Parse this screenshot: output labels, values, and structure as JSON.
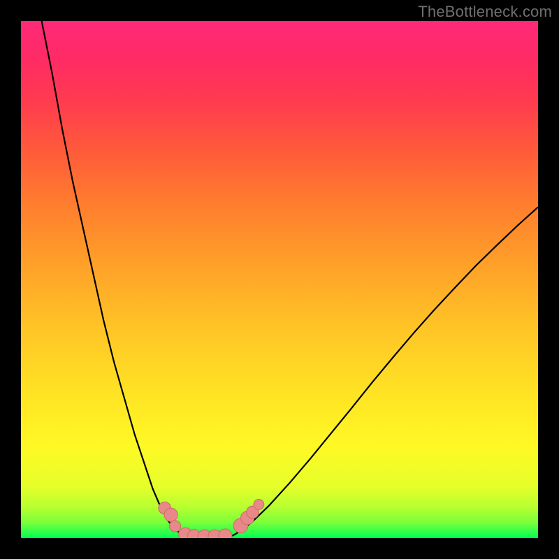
{
  "watermark": "TheBottleneck.com",
  "chart_data": {
    "type": "line",
    "title": "",
    "xlabel": "",
    "ylabel": "",
    "xlim": [
      0,
      100
    ],
    "ylim": [
      0,
      100
    ],
    "grid": false,
    "legend": null,
    "background_gradient": {
      "stops": [
        {
          "pos": 0,
          "color": "#00ff55"
        },
        {
          "pos": 3,
          "color": "#7aff3a"
        },
        {
          "pos": 6,
          "color": "#b8ff30"
        },
        {
          "pos": 10,
          "color": "#e6ff2a"
        },
        {
          "pos": 18,
          "color": "#fff825"
        },
        {
          "pos": 28,
          "color": "#ffe324"
        },
        {
          "pos": 40,
          "color": "#ffc626"
        },
        {
          "pos": 52,
          "color": "#ffa328"
        },
        {
          "pos": 64,
          "color": "#ff7f2e"
        },
        {
          "pos": 75,
          "color": "#ff5a3a"
        },
        {
          "pos": 85,
          "color": "#ff3a50"
        },
        {
          "pos": 93,
          "color": "#ff2a66"
        },
        {
          "pos": 100,
          "color": "#ff2a78"
        }
      ]
    },
    "series": [
      {
        "name": "left-curve",
        "x": [
          4,
          6,
          8,
          10,
          12,
          14,
          16,
          18,
          20,
          22,
          24,
          25.5,
          27,
          28.5,
          30,
          31.5
        ],
        "y": [
          100,
          90,
          79,
          69,
          60,
          51,
          42,
          34,
          27,
          20,
          14,
          9.5,
          6,
          3.3,
          1.5,
          0.5
        ]
      },
      {
        "name": "valley-floor",
        "x": [
          31.5,
          33,
          35,
          37,
          39,
          41
        ],
        "y": [
          0.5,
          0.15,
          0.05,
          0.05,
          0.15,
          0.5
        ]
      },
      {
        "name": "right-curve",
        "x": [
          41,
          43,
          45,
          48,
          52,
          56,
          60,
          64,
          68,
          72,
          76,
          80,
          84,
          88,
          92,
          96,
          100
        ],
        "y": [
          0.5,
          1.7,
          3.4,
          6.3,
          10.7,
          15.4,
          20.3,
          25.2,
          30.2,
          35.0,
          39.7,
          44.2,
          48.5,
          52.7,
          56.6,
          60.4,
          64.0
        ]
      }
    ],
    "markers": [
      {
        "x": 27.8,
        "y": 5.8,
        "r": 1.2
      },
      {
        "x": 29.0,
        "y": 4.5,
        "r": 1.3
      },
      {
        "x": 29.8,
        "y": 2.3,
        "r": 1.1
      },
      {
        "x": 31.8,
        "y": 0.7,
        "r": 1.3
      },
      {
        "x": 33.5,
        "y": 0.35,
        "r": 1.3
      },
      {
        "x": 35.5,
        "y": 0.3,
        "r": 1.3
      },
      {
        "x": 37.5,
        "y": 0.3,
        "r": 1.3
      },
      {
        "x": 39.5,
        "y": 0.45,
        "r": 1.3
      },
      {
        "x": 42.5,
        "y": 2.4,
        "r": 1.4
      },
      {
        "x": 43.8,
        "y": 3.9,
        "r": 1.3
      },
      {
        "x": 44.8,
        "y": 5.0,
        "r": 1.2
      },
      {
        "x": 46.0,
        "y": 6.5,
        "r": 1.0
      }
    ]
  }
}
